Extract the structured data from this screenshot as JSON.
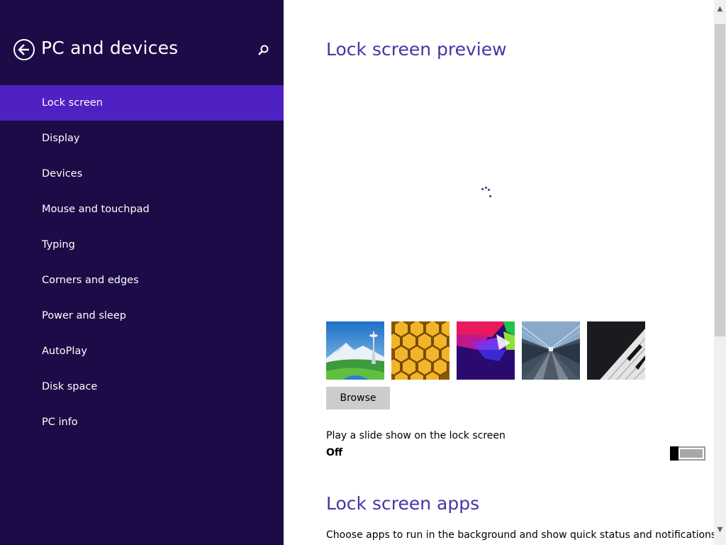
{
  "sidebar": {
    "title": "PC and devices",
    "back_icon": "back-arrow-icon",
    "search_icon": "search-icon",
    "items": [
      {
        "label": "Lock screen",
        "active": true
      },
      {
        "label": "Display"
      },
      {
        "label": "Devices"
      },
      {
        "label": "Mouse and touchpad"
      },
      {
        "label": "Typing"
      },
      {
        "label": "Corners and edges"
      },
      {
        "label": "Power and sleep"
      },
      {
        "label": "AutoPlay"
      },
      {
        "label": "Disk space"
      },
      {
        "label": "PC info"
      }
    ]
  },
  "main": {
    "preview_heading": "Lock screen preview",
    "thumbnails": [
      {
        "name": "space-needle"
      },
      {
        "name": "honeycomb"
      },
      {
        "name": "geometric"
      },
      {
        "name": "train-track"
      },
      {
        "name": "piano-keys"
      }
    ],
    "browse_label": "Browse",
    "slideshow_label": "Play a slide show on the lock screen",
    "slideshow_state": "Off",
    "apps_heading": "Lock screen apps",
    "apps_description": "Choose apps to run in the background and show quick status and notifications,"
  },
  "colors": {
    "sidebar_bg": "#1c0b47",
    "active_item_bg": "#4f21c2",
    "heading": "#4a33a6"
  }
}
